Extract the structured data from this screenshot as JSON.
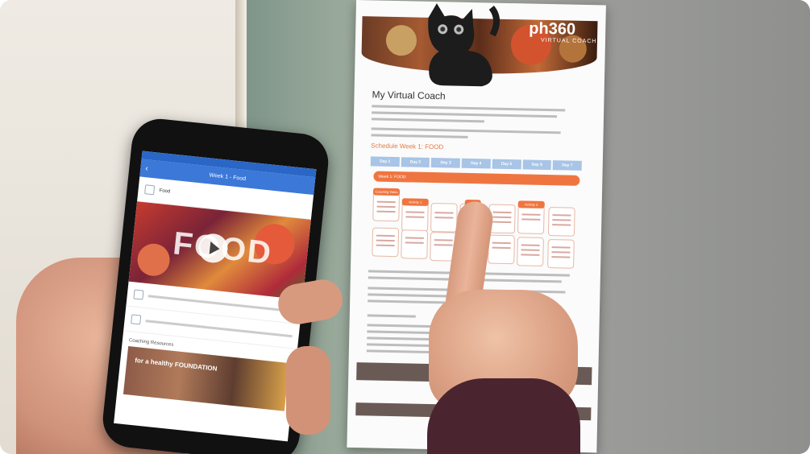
{
  "scene": {
    "description_colors": {
      "fridge": "#9c9d9a",
      "accent_orange": "#ef7540",
      "accent_blue": "#3b78d8"
    }
  },
  "paper": {
    "logo": "ph360",
    "logo_sub": "VIRTUAL COACH",
    "title": "My Virtual Coach",
    "schedule_heading": "Schedule Week 1: FOOD",
    "days": [
      "Day 1",
      "Day 2",
      "Day 3",
      "Day 4",
      "Day 5",
      "Day 6",
      "Day 7"
    ],
    "week_bar": "Week 1: FOOD",
    "top_cards": [
      "Coaching Video",
      "Activity 1",
      "",
      "",
      "Videos",
      "Activity 3",
      "Recipes"
    ],
    "footer": "Login online"
  },
  "phone": {
    "screen_title": "Week 1 - Food",
    "item_title": "Food",
    "hero_text": "FOOD",
    "section_title": "Coaching Resources",
    "promo_text": "for a healthy FOUNDATION",
    "icons": {
      "back": "chevron-left-icon",
      "play": "play-icon"
    }
  }
}
